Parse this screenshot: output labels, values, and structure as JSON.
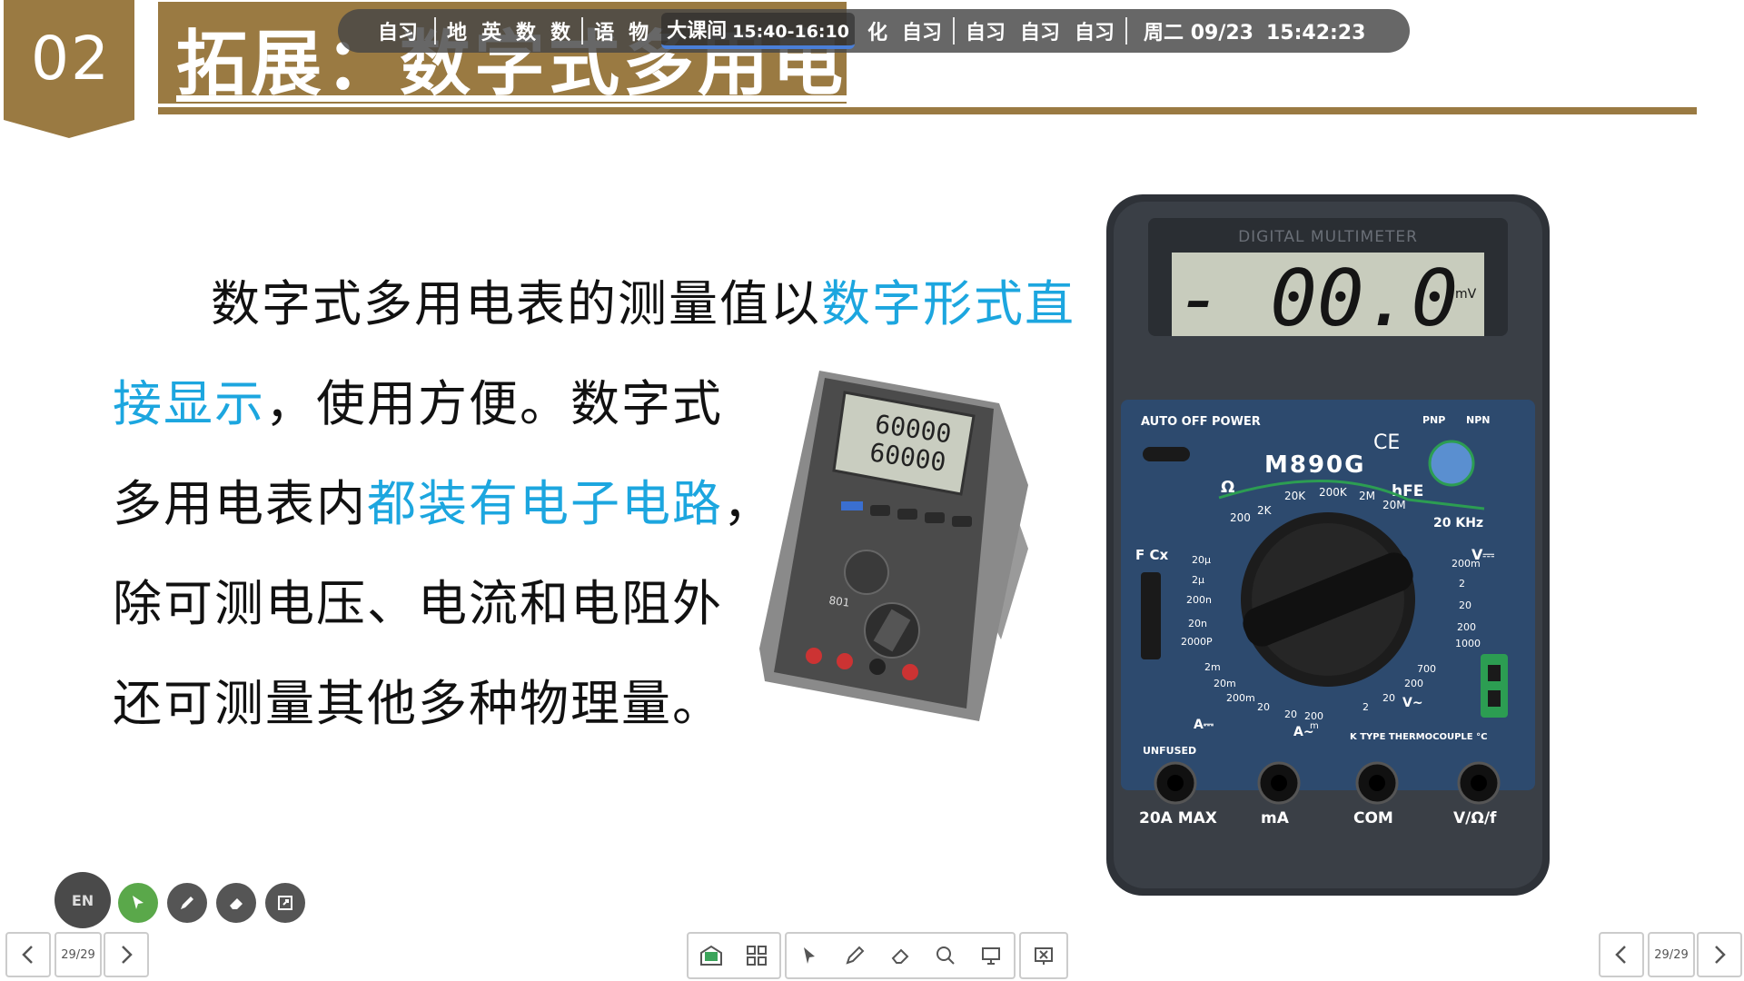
{
  "section": {
    "number": "02",
    "title": "拓展：数字式多用电表"
  },
  "schedule": {
    "items": [
      "自习",
      "地",
      "英",
      "数",
      "数",
      "语",
      "物"
    ],
    "current": {
      "label": "大课间",
      "time": "15:40-16:10"
    },
    "after": [
      "化",
      "自习",
      "自习",
      "自习",
      "自习"
    ],
    "date": "周二 09/23",
    "time": "15:42:23"
  },
  "body": {
    "line1_a": "数字式多用电表的测量值以",
    "line1_b": "数字形式直",
    "line2_a": "接显示",
    "line2_b": "，使用方便。数字式",
    "line3_a": "多用电表内",
    "line3_b": "都装有电子电路",
    "line3_c": "，",
    "line4": "除可测电压、电流和电阻外",
    "line5": "还可测量其他多种物理量。"
  },
  "meter_small": {
    "reading1": "60000",
    "reading2": "60000",
    "brand": "801"
  },
  "meter_big": {
    "header": "DIGITAL MULTIMETER",
    "display": "- 00.0",
    "unit": "mV",
    "model": "M890G",
    "power": "AUTO OFF POWER",
    "ce": "CE",
    "unfused": "UNFUSED",
    "jacks": [
      "20A MAX",
      "mA",
      "COM",
      "V/Ω/f"
    ],
    "thermo": "K TYPE THERMOCOUPLE °C",
    "labels": {
      "ohm": "Ω",
      "ohm_ranges": [
        "200",
        "2K",
        "20K",
        "200K",
        "2M",
        "20M"
      ],
      "hfe": "hFE",
      "khz": "20 KHz",
      "vdc": "V⎓",
      "vdc_ranges": [
        "200m",
        "2",
        "20",
        "200",
        "1000"
      ],
      "cap": "F Cx",
      "cap_ranges": [
        "20μ",
        "2μ",
        "200n",
        "20n",
        "2000P"
      ],
      "adc": "A⎓",
      "adc_ranges": [
        "2m",
        "20m",
        "200m",
        "20"
      ],
      "aac": "A~",
      "aac_ranges": [
        "20",
        "200",
        "m"
      ],
      "vac": "V~",
      "vac_ranges": [
        "700",
        "200",
        "20",
        "2"
      ],
      "pnp": "PNP",
      "npn": "NPN"
    }
  },
  "tools": {
    "lang": "EN"
  },
  "nav": {
    "page": "29/29"
  },
  "colors": {
    "brown": "#9a7a42",
    "highlight": "#1ca6df",
    "meter_blue": "#2d4a6e"
  }
}
